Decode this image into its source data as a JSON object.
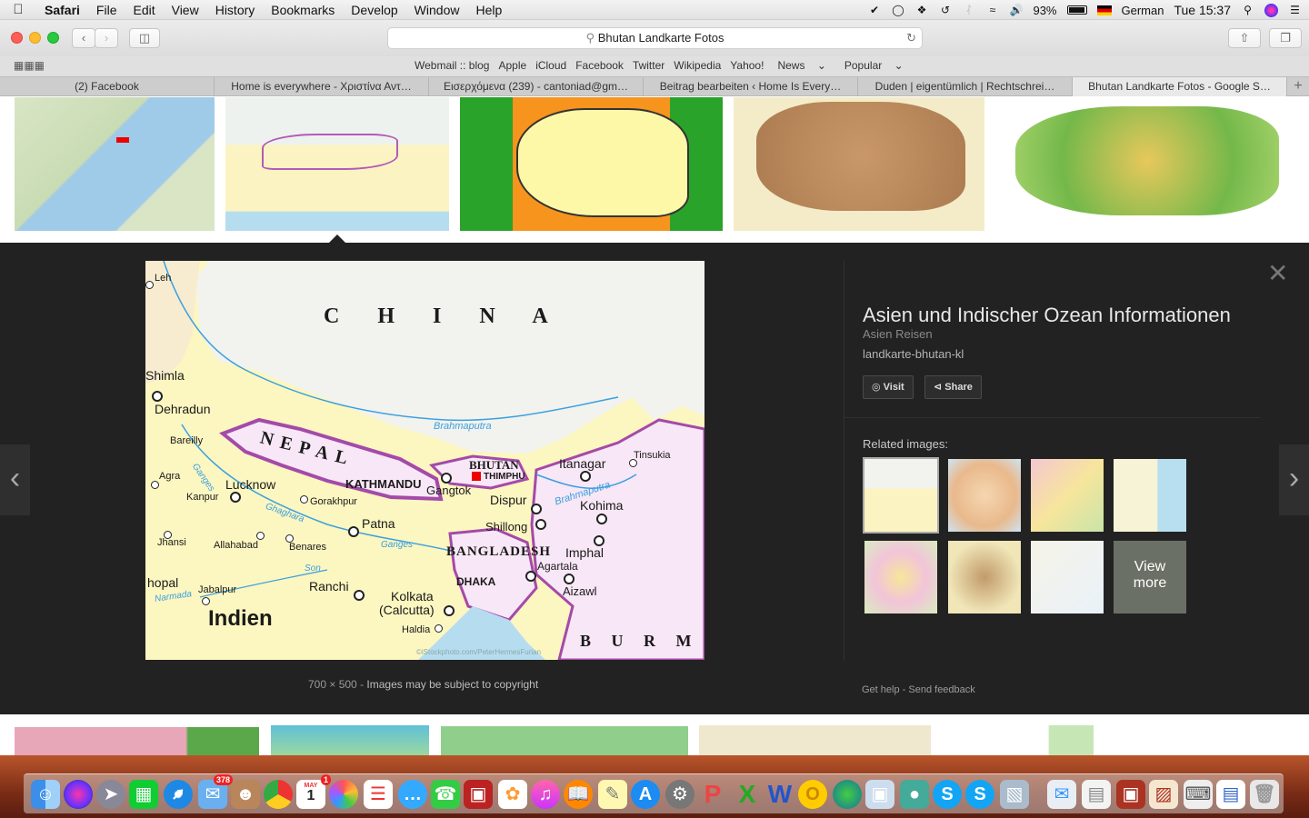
{
  "menubar": {
    "app": "Safari",
    "items": [
      "File",
      "Edit",
      "View",
      "History",
      "Bookmarks",
      "Develop",
      "Window",
      "Help"
    ],
    "battery": "93%",
    "input_source": "German",
    "clock": "Tue 15:37"
  },
  "toolbar": {
    "url": "Bhutan Landkarte Fotos"
  },
  "favorites": [
    "Webmail :: blog",
    "Apple",
    "iCloud",
    "Facebook",
    "Twitter",
    "Wikipedia",
    "Yahoo!",
    "News",
    "Popular"
  ],
  "tabs": [
    {
      "label": "(2) Facebook",
      "active": false
    },
    {
      "label": "Home is everywhere - Χριστίνα Αντ…",
      "active": false
    },
    {
      "label": "Εισερχόμενα (239) - cantoniad@gm…",
      "active": false
    },
    {
      "label": "Beitrag bearbeiten ‹ Home Is Every…",
      "active": false
    },
    {
      "label": "Duden | eigentümlich | Rechtschrei…",
      "active": false
    },
    {
      "label": "Bhutan Landkarte Fotos - Google S…",
      "active": true
    }
  ],
  "map": {
    "china": "C H I N A",
    "nepal": "NEPAL",
    "bhutan": "BHUTAN",
    "thimphu": "THIMPHU",
    "bangladesh": "BANGLADESH",
    "burma": "B U R M A",
    "indien": "Indien",
    "brahmaputra": "Brahmaputra",
    "brahmaputra2": "Brahmaputra",
    "ganges": "Ganges",
    "ganges2": "Ganges",
    "ghaghara": "Ghaghara",
    "son": "Son",
    "narmada": "Narmada",
    "dhaka": "DHAKA",
    "kathmandu": "KATHMANDU",
    "leh": "Leh",
    "shimla": "Shimla",
    "dehradun": "Dehradun",
    "bareilly": "Bareilly",
    "agra": "Agra",
    "lucknow": "Lucknow",
    "kanpur": "Kanpur",
    "gorakhpur": "Gorakhpur",
    "patna": "Patna",
    "jhansi": "Jhansi",
    "allahabad": "Allahabad",
    "benares": "Benares",
    "bhopal": "hopal",
    "jabalpur": "Jabalpur",
    "ranchi": "Ranchi",
    "kolkata": "Kolkata",
    "calcutta": "(Calcutta)",
    "haldia": "Haldia",
    "gangtok": "Gangtok",
    "itanagar": "Itanagar",
    "tinsukia": "Tinsukia",
    "dispur": "Dispur",
    "kohima": "Kohima",
    "shillong": "Shillong",
    "imphal": "Imphal",
    "agartala": "Agartala",
    "aizawl": "Aizawl",
    "credit": "©iStockphoto.com/PeterHermesFurian"
  },
  "caption": {
    "size": "700 × 500",
    "sep": "-",
    "copyright": "Images may be subject to copyright"
  },
  "info": {
    "title": "Asien und Indischer Ozean Informationen",
    "site": "Asien Reisen",
    "filename": "landkarte-bhutan-kl",
    "visit": "Visit",
    "share": "Share",
    "related": "Related images:",
    "view_more_1": "View",
    "view_more_2": "more",
    "get_help": "Get help",
    "sep": "-",
    "feedback": "Send feedback"
  },
  "dock": {
    "mail_badge": "378",
    "calendar_badge": "1",
    "calendar_month": "MAY",
    "calendar_day": "1"
  },
  "colors": {
    "panel_bg": "#222222",
    "map_land": "#fcf6c0",
    "map_china": "#f2f2f0",
    "border_purple": "#a44aa8",
    "river_blue": "#3aa0e0"
  }
}
